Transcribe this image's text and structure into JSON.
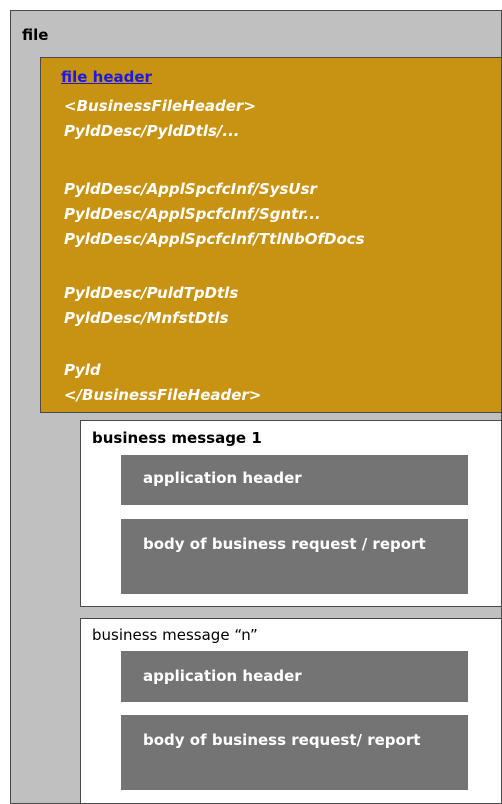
{
  "file": {
    "label": "file"
  },
  "header": {
    "title": "file header",
    "lines": [
      "<BusinessFileHeader>",
      "PyldDesc/PyldDtls/...",
      "PyldDesc/ApplSpcfcInf/SysUsr",
      "PyldDesc/ApplSpcfcInf/Sgntr...",
      "PyldDesc/ApplSpcfcInf/TtlNbOfDocs",
      "PyldDesc/PuldTpDtls",
      "PyldDesc/MnfstDtls",
      "Pyld",
      "</BusinessFileHeader>"
    ]
  },
  "messages": [
    {
      "title": "business message 1",
      "app_header": "application header",
      "body": "body of business request / report"
    },
    {
      "title": "business message “n”",
      "app_header": "application header",
      "body": "body of business request/ report"
    }
  ]
}
